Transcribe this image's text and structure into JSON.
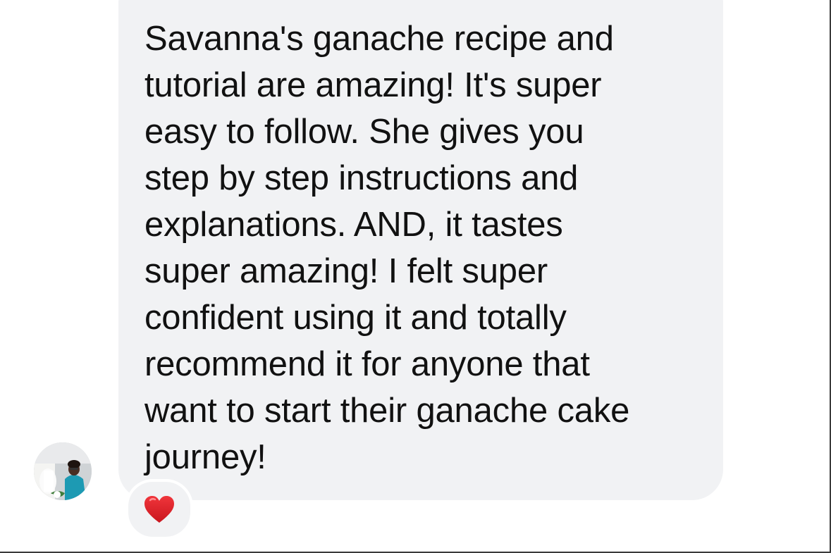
{
  "message": {
    "lines": [
      "Savanna's ganache recipe and",
      "tutorial are amazing! It's super",
      "easy to follow. She gives you",
      "step by step instructions and",
      "explanations. AND, it tastes",
      "super amazing! I felt super",
      "confident using it and totally",
      "recommend it for anyone that",
      "want to start their ganache cake",
      "journey!"
    ]
  },
  "reaction": {
    "icon": "red-heart-icon",
    "color": "#e0242b"
  },
  "sender": {
    "avatar_icon": "profile-photo-avatar"
  },
  "colors": {
    "bubble": "#f1f2f4",
    "text": "#111111",
    "background": "#ffffff"
  }
}
